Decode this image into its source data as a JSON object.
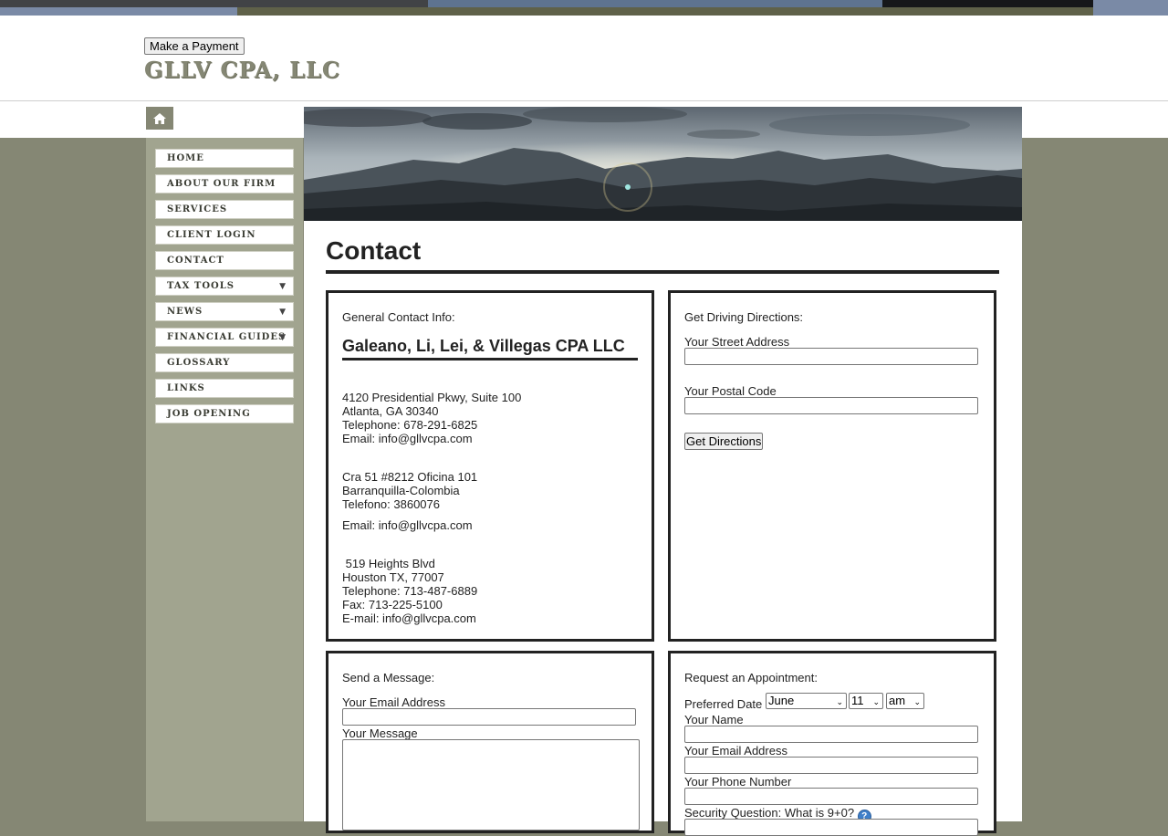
{
  "colors": {
    "page_background": "#858774",
    "sidebar": "#a1a48f",
    "logo": "#858774",
    "rule": "#222222"
  },
  "header": {
    "payment_button": "Make a Payment",
    "logo_text": "GLLV CPA, LLC"
  },
  "home_icon": "home-icon",
  "nav": {
    "items": [
      {
        "label": "HOME",
        "submenu": false
      },
      {
        "label": "ABOUT OUR FIRM",
        "submenu": false
      },
      {
        "label": "SERVICES",
        "submenu": false
      },
      {
        "label": "CLIENT LOGIN",
        "submenu": false
      },
      {
        "label": "CONTACT",
        "submenu": false
      },
      {
        "label": "TAX TOOLS",
        "submenu": true
      },
      {
        "label": "NEWS",
        "submenu": true
      },
      {
        "label": "FINANCIAL GUIDES",
        "submenu": true
      },
      {
        "label": "GLOSSARY",
        "submenu": false
      },
      {
        "label": "LINKS",
        "submenu": false
      },
      {
        "label": "JOB OPENING",
        "submenu": false
      }
    ],
    "caret": "▼"
  },
  "page": {
    "title": "Contact"
  },
  "contact_info": {
    "heading": "General Contact Info:",
    "firm_name": "Galeano, Li, Lei, & Villegas CPA LLC",
    "offices": [
      {
        "lines": [
          "4120 Presidential Pkwy, Suite 100",
          "Atlanta, GA 30340",
          "Telephone: 678-291-6825",
          "Email: info@gllvcpa.com"
        ]
      },
      {
        "lines": [
          "Cra 51 #8212 Oficina 101",
          "Barranquilla-Colombia",
          "Telefono: 3860076"
        ]
      },
      {
        "lines": [
          "Email: info@gllvcpa.com"
        ]
      },
      {
        "lines": [
          " 519 Heights Blvd",
          "Houston TX, 77007",
          "Telephone: 713-487-6889",
          "Fax: 713-225-5100",
          "E-mail: info@gllvcpa.com"
        ]
      }
    ]
  },
  "directions": {
    "heading": "Get Driving Directions:",
    "street_label": "Your Street Address",
    "postal_label": "Your Postal Code",
    "button": "Get Directions"
  },
  "message": {
    "heading": "Send a Message:",
    "email_label": "Your Email Address",
    "message_label": "Your Message"
  },
  "appointment": {
    "heading": "Request an Appointment:",
    "date_label": "Preferred Date",
    "month": "June",
    "day": "11",
    "ampm": "am",
    "select_arrow": "⌄",
    "name_label": "Your Name",
    "email_label": "Your Email Address",
    "phone_label": "Your Phone Number",
    "security_label": "Security Question: What is 9+0?",
    "help_icon": "help-icon",
    "help_glyph": "?"
  }
}
